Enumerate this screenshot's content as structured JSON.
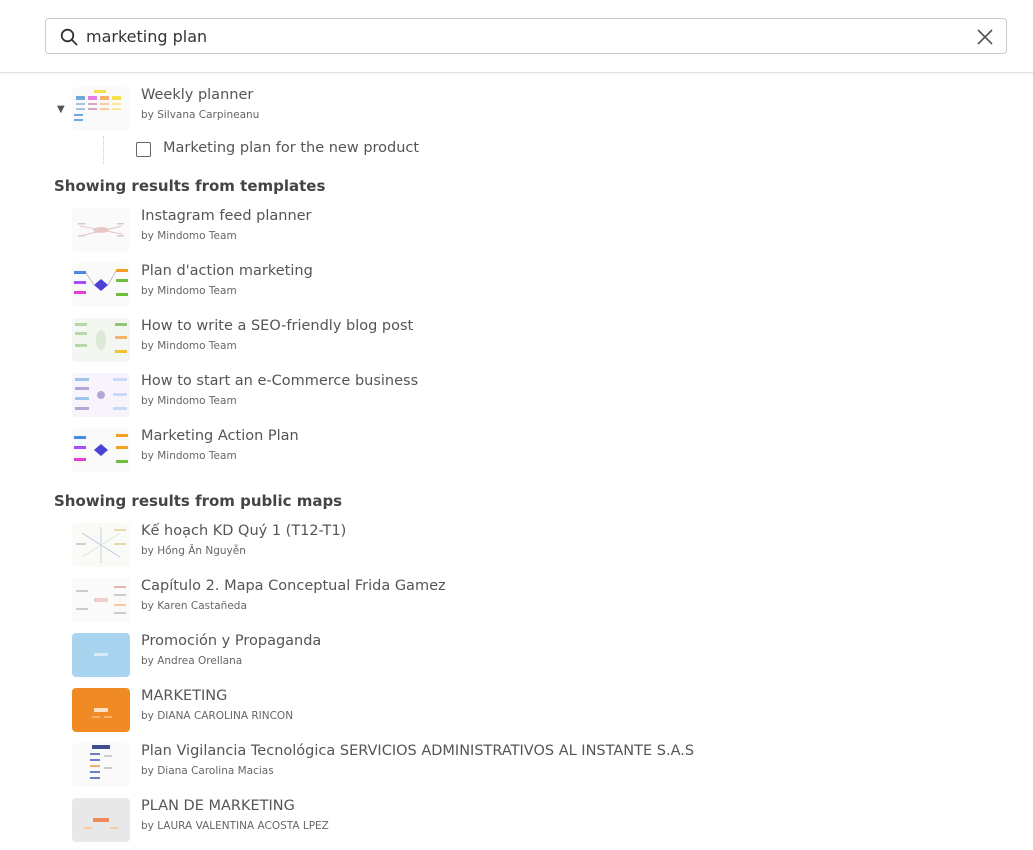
{
  "search": {
    "value": "marketing plan"
  },
  "top_item": {
    "title": "Weekly planner",
    "author": "by Silvana Carpineanu",
    "child": {
      "label": "Marketing plan for the new product"
    }
  },
  "templates": {
    "heading": "Showing results from templates",
    "items": [
      {
        "title": "Instagram feed planner",
        "author": "by Mindomo Team"
      },
      {
        "title": "Plan d'action marketing",
        "author": "by Mindomo Team"
      },
      {
        "title": "How to write a SEO-friendly blog post",
        "author": "by Mindomo Team"
      },
      {
        "title": "How to start an e-Commerce business",
        "author": "by Mindomo Team"
      },
      {
        "title": "Marketing Action Plan",
        "author": "by Mindomo Team"
      }
    ]
  },
  "public_maps": {
    "heading": "Showing results from public maps",
    "items": [
      {
        "title": "Kế hoạch KD Quý 1 (T12-T1)",
        "author": "by Hồng Ân Nguyễn"
      },
      {
        "title": "Capítulo 2. Mapa Conceptual Frida Gamez",
        "author": "by Karen Castañeda"
      },
      {
        "title": "Promoción y Propaganda",
        "author": "by Andrea Orellana"
      },
      {
        "title": "MARKETING",
        "author": "by DIANA CAROLINA RINCON"
      },
      {
        "title": "Plan Vigilancia Tecnológica SERVICIOS ADMINISTRATIVOS AL INSTANTE S.A.S",
        "author": "by Diana Carolina Macias"
      },
      {
        "title": "PLAN DE MARKETING",
        "author": "by LAURA VALENTINA ACOSTA LPEZ"
      }
    ]
  },
  "colors": {
    "blue_thumb": "#a9d4ef",
    "orange_thumb": "#f08a24",
    "grey_thumb": "#e8e8e8"
  }
}
